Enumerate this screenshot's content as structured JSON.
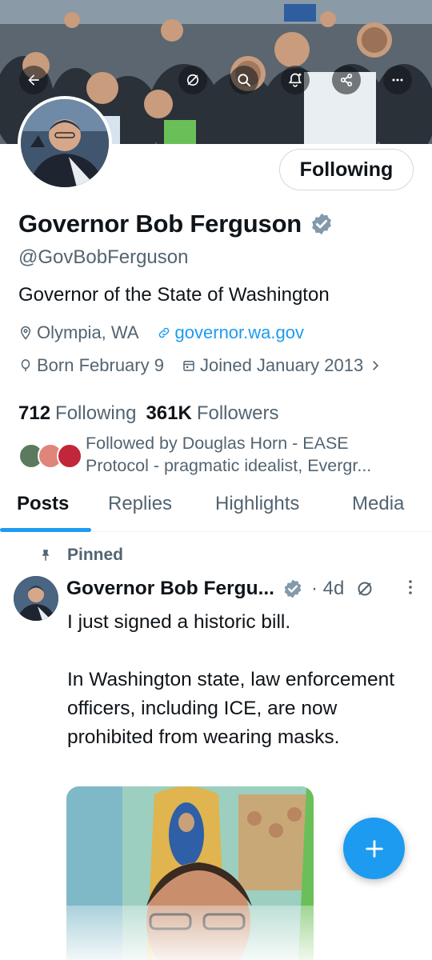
{
  "profile": {
    "display_name": "Governor Bob Ferguson",
    "handle": "@GovBobFerguson",
    "bio": "Governor of the State of Washington",
    "location": "Olympia, WA",
    "website": "governor.wa.gov",
    "born": "Born February 9",
    "joined": "Joined January 2013",
    "follow_button": "Following",
    "following_count": "712",
    "following_label": "Following",
    "followers_count": "361K",
    "followers_label": "Followers",
    "followed_by": "Followed by Douglas Horn - EASE Protocol - pragmatic idealist, Evergr..."
  },
  "header_icons": [
    "back-arrow-icon",
    "grok-icon",
    "search-icon",
    "notification-bell-icon",
    "share-icon",
    "more-icon"
  ],
  "tabs": [
    {
      "label": "Posts",
      "active": true
    },
    {
      "label": "Replies",
      "active": false
    },
    {
      "label": "Highlights",
      "active": false
    },
    {
      "label": "Media",
      "active": false
    }
  ],
  "post": {
    "pinned_label": "Pinned",
    "author": "Governor Bob Fergu...",
    "time": "· 4d",
    "lines": [
      "I just signed a historic bill.",
      "",
      "In Washington state, law enforcement officers, including ICE, are now prohibited from wearing masks."
    ]
  },
  "colors": {
    "accent": "#1d9bf0",
    "text_primary": "#0f1419",
    "text_secondary": "#536471",
    "verified": "#829aab"
  }
}
